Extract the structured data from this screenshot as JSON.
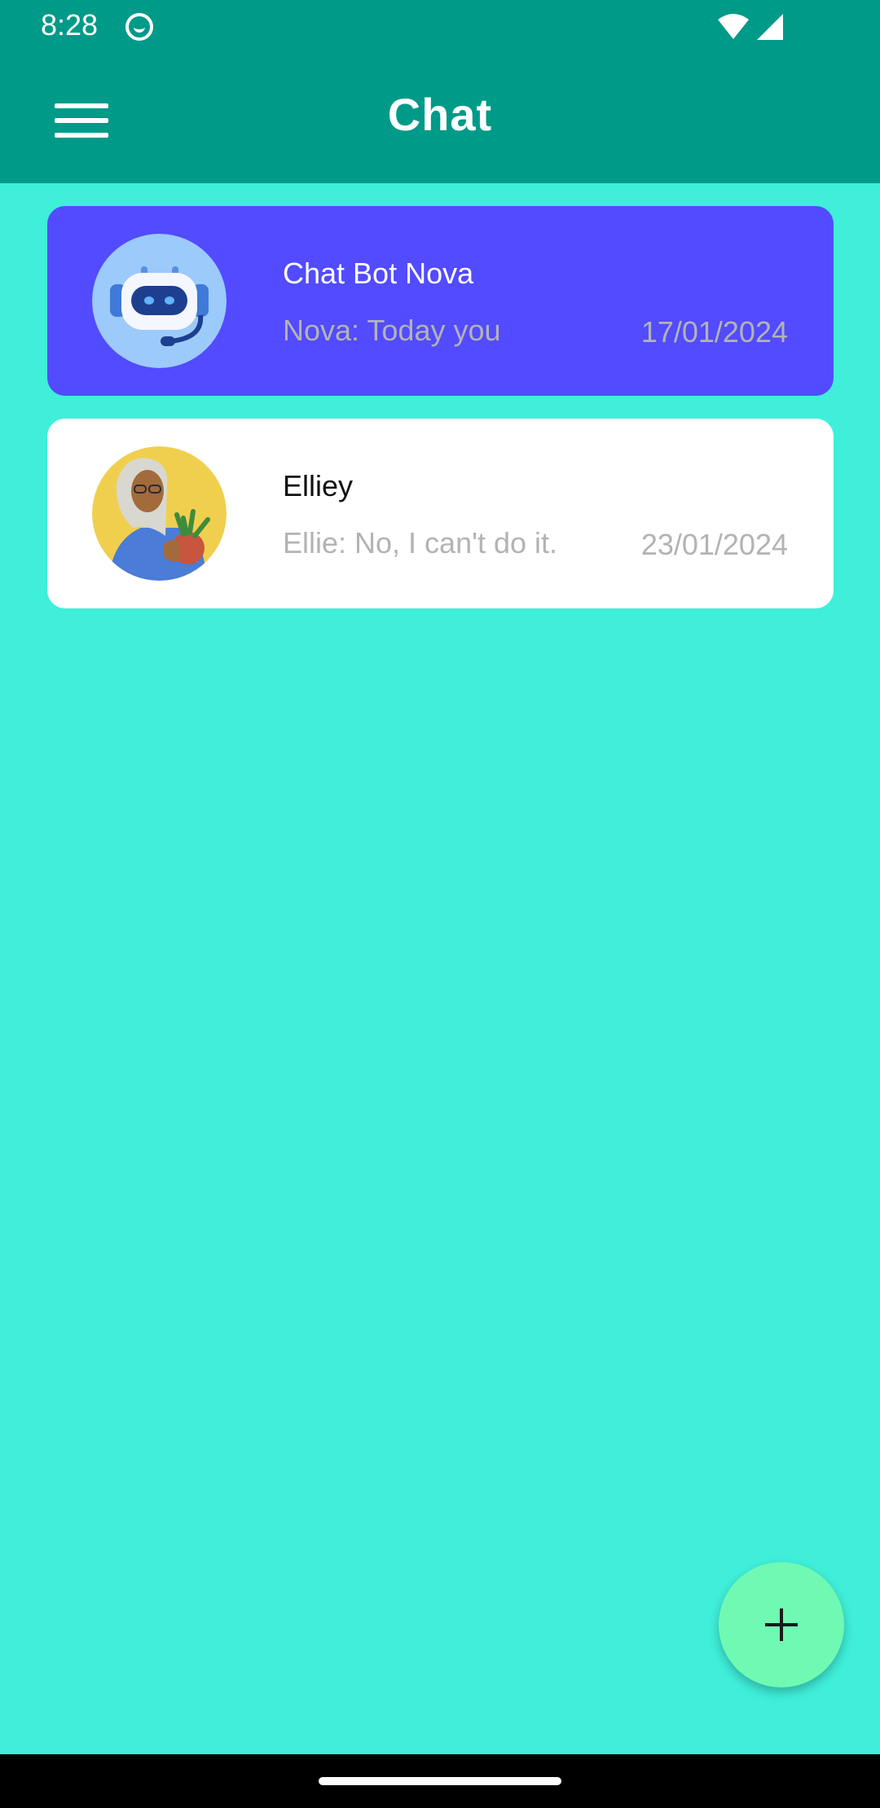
{
  "status_bar": {
    "time": "8:28",
    "icons": [
      "app-notification-icon",
      "wifi-icon",
      "signal-icon"
    ]
  },
  "app_bar": {
    "title": "Chat",
    "menu_icon": "menu-icon"
  },
  "chats": [
    {
      "name": "Chat Bot Nova",
      "preview": "Nova: Today you",
      "date": "17/01/2024",
      "avatar": "robot-avatar",
      "selected": true
    },
    {
      "name": "Elliey",
      "preview": "Ellie: No, I can't do it.",
      "date": "23/01/2024",
      "avatar": "woman-with-plant-avatar",
      "selected": false
    }
  ],
  "fab": {
    "icon": "plus-icon"
  },
  "colors": {
    "app_bar": "#009a89",
    "background": "#3fefd9",
    "selected_card": "#524bff",
    "card": "#ffffff",
    "fab": "#6ff9b3",
    "muted_text": "#b3b3b3"
  }
}
